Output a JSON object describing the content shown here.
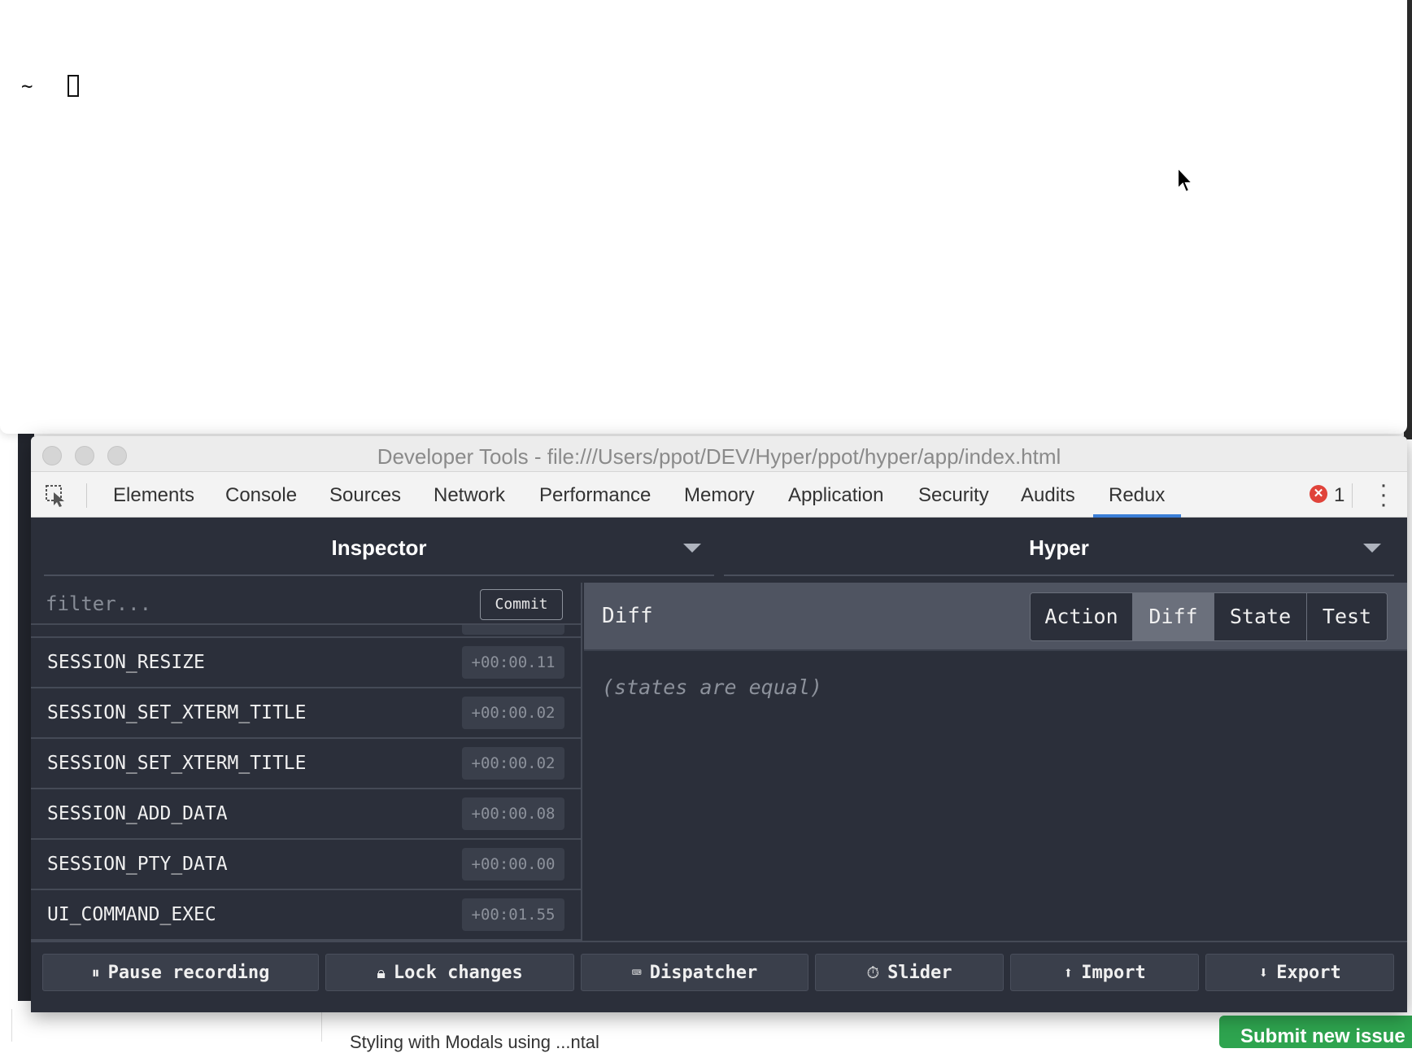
{
  "terminal": {
    "prompt": "~"
  },
  "devtools": {
    "window_title": "Developer Tools - file:///Users/ppot/DEV/Hyper/ppot/hyper/app/index.html",
    "tabs": [
      "Elements",
      "Console",
      "Sources",
      "Network",
      "Performance",
      "Memory",
      "Application",
      "Security",
      "Audits",
      "Redux"
    ],
    "active_tab": "Redux",
    "error_count": "1"
  },
  "redux": {
    "monitor_select": "Inspector",
    "instance_select": "Hyper",
    "filter_placeholder": "filter...",
    "commit_label": "Commit",
    "actions": [
      {
        "name": "SESSION_RESIZE",
        "time": "+00:00.11"
      },
      {
        "name": "SESSION_SET_XTERM_TITLE",
        "time": "+00:00.02"
      },
      {
        "name": "SESSION_SET_XTERM_TITLE",
        "time": "+00:00.02"
      },
      {
        "name": "SESSION_ADD_DATA",
        "time": "+00:00.08"
      },
      {
        "name": "SESSION_PTY_DATA",
        "time": "+00:00.00"
      },
      {
        "name": "UI_COMMAND_EXEC",
        "time": "+00:01.55"
      }
    ],
    "detail_title": "Diff",
    "detail_tabs": [
      "Action",
      "Diff",
      "State",
      "Test"
    ],
    "active_detail_tab": "Diff",
    "diff_message": "(states are equal)",
    "bottom_buttons": [
      {
        "label": "Pause recording",
        "icon": "pause-icon"
      },
      {
        "label": "Lock changes",
        "icon": "lock-icon"
      },
      {
        "label": "Dispatcher",
        "icon": "keyboard-icon"
      },
      {
        "label": "Slider",
        "icon": "stopwatch-icon"
      },
      {
        "label": "Import",
        "icon": "upload-icon"
      },
      {
        "label": "Export",
        "icon": "download-icon"
      }
    ]
  },
  "background_page": {
    "partial_text": "Styling with Modals using ...ntal",
    "submit_label": "Submit new issue"
  },
  "colors": {
    "panel_bg": "#2b2f3a",
    "active_tab_underline": "#3b7ed6",
    "error_red": "#e0433a",
    "submit_green": "#2ea44f"
  }
}
